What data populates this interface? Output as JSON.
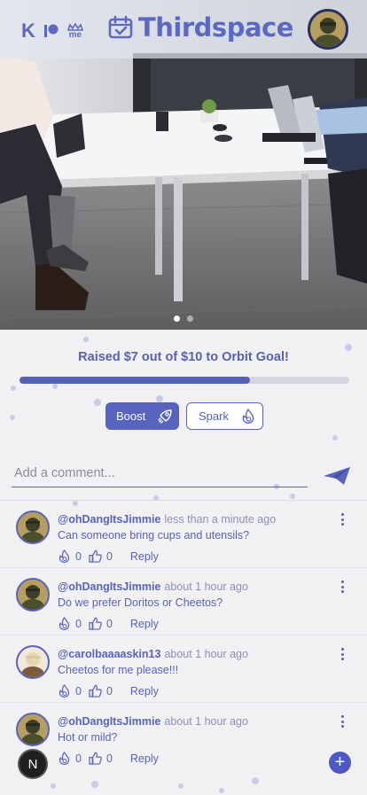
{
  "header": {
    "brand_k": "K",
    "brand_me": "me",
    "title": "Thirdspace",
    "accent": "#5c69c2"
  },
  "carousel": {
    "image_alt": "Office meeting table with laptops",
    "slides": 2,
    "active_slide": 1
  },
  "goal": {
    "text": "Raised $7 out of $10 to Orbit Goal!",
    "raised": 7,
    "target": 10,
    "progress_fraction": 0.7
  },
  "actions": {
    "boost_label": "Boost",
    "boost_icon": "rocket-icon",
    "spark_label": "Spark",
    "spark_icon": "flame-icon"
  },
  "comment_box": {
    "placeholder": "Add a comment...",
    "value": "",
    "send_icon": "send-icon"
  },
  "comments": [
    {
      "user": "@ohDangItsJimmie",
      "time": "less than a minute ago",
      "text": "Can someone bring cups and utensils?",
      "sparks": "0",
      "likes": "0",
      "reply": "Reply"
    },
    {
      "user": "@ohDangItsJimmie",
      "time": "about 1 hour ago",
      "text": "Do we prefer Doritos or Cheetos?",
      "sparks": "0",
      "likes": "0",
      "reply": "Reply"
    },
    {
      "user": "@carolbaaaaskin13",
      "time": "about 1 hour ago",
      "text": "Cheetos for me please!!!",
      "sparks": "0",
      "likes": "0",
      "reply": "Reply"
    },
    {
      "user": "@ohDangItsJimmie",
      "time": "about 1 hour ago",
      "text": "Hot or mild?",
      "sparks": "0",
      "likes": "0",
      "reply": "Reply"
    }
  ],
  "floating": {
    "left_badge": "N",
    "right_button": "+"
  }
}
